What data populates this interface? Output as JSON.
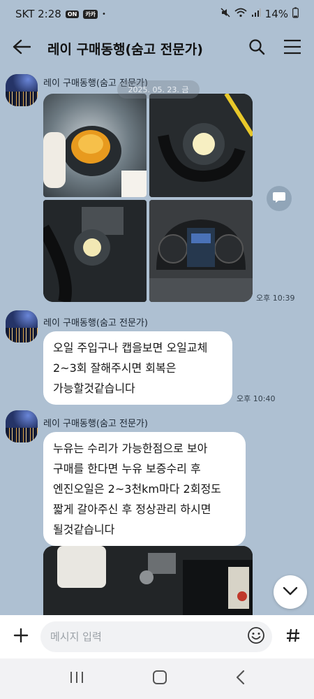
{
  "status": {
    "carrier_time": "SKT 2:28",
    "badge_1": "ON",
    "badge_2": "카카",
    "dot": "•",
    "battery": "14%"
  },
  "header": {
    "title": "레이 구매동행(숨고 전문가)"
  },
  "chat": {
    "date_label": "2025. 05. 23. 금",
    "messages": [
      {
        "sender": "레이 구매동행(숨고 전문가)",
        "type": "photos",
        "time": "오후 10:39"
      },
      {
        "sender": "레이 구매동행(숨고 전문가)",
        "type": "text",
        "text": "오일 주입구나 캡을보면 오일교체\n2~3회 잘해주시면 회복은\n가능할것같습니다",
        "time": "오후 10:40"
      },
      {
        "sender": "레이 구매동행(숨고 전문가)",
        "type": "text",
        "text": "누유는 수리가 가능한점으로 보아\n구매를 한다면 누유 보증수리 후\n엔진오일은 2~3천km마다 2회정도\n짧게 갈아주신 후 정상관리 하시면\n될것같습니다"
      },
      {
        "sender": "레이 구매동행(숨고 전문가)",
        "type": "photo"
      }
    ]
  },
  "input": {
    "placeholder": "메시지 입력"
  },
  "icons": {
    "back": "arrow-left-icon",
    "search": "search-icon",
    "menu": "hamburger-icon",
    "share": "share-icon",
    "scroll": "chevron-down-icon",
    "plus": "plus-icon",
    "emoji": "emoji-icon",
    "hash": "hash-icon"
  }
}
